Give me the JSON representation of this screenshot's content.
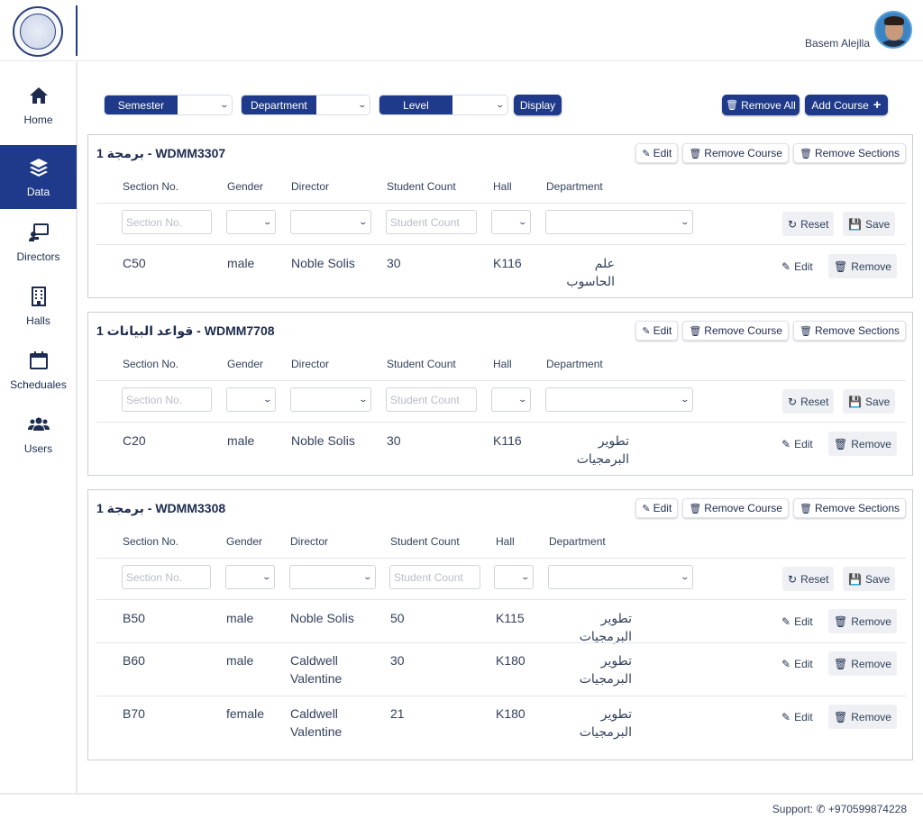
{
  "header": {
    "username": "Basem Alejlla",
    "logo_icon": "university-logo",
    "avatar_icon": "user-avatar"
  },
  "sidebar": {
    "items": [
      {
        "label": "Home",
        "icon": "home-icon",
        "active": false
      },
      {
        "label": "Data",
        "icon": "layers-icon",
        "active": true
      },
      {
        "label": "Directors",
        "icon": "chalkboard-teacher-icon",
        "active": false
      },
      {
        "label": "Halls",
        "icon": "building-icon",
        "active": false
      },
      {
        "label": "Scheduales",
        "icon": "calendar-icon",
        "active": false
      },
      {
        "label": "Users",
        "icon": "users-icon",
        "active": false
      }
    ]
  },
  "filters": {
    "semester_label": "Semester",
    "department_label": "Department",
    "level_label": "Level",
    "display_label": "Display",
    "remove_all_label": "Remove All",
    "add_course_label": "Add Course"
  },
  "actions": {
    "edit": "Edit",
    "remove_course": "Remove Course",
    "remove_sections": "Remove Sections",
    "reset": "Reset",
    "save": "Save",
    "remove": "Remove"
  },
  "columns": [
    "Section No.",
    "Gender",
    "Director",
    "Student Count",
    "Hall",
    "Department"
  ],
  "placeholders": {
    "section_no": "Section No.",
    "student_count": "Student Count"
  },
  "courses": [
    {
      "title": "برمجة 1 - WDMM3307",
      "sections": [
        {
          "section": "C50",
          "gender": "male",
          "director": "Noble Solis",
          "count": "30",
          "hall": "K116",
          "department": "علم الحاسوب"
        }
      ]
    },
    {
      "title": "قواعد البيانات 1 - WDMM7708",
      "sections": [
        {
          "section": "C20",
          "gender": "male",
          "director": "Noble Solis",
          "count": "30",
          "hall": "K116",
          "department": "تطوير البرمجيات"
        }
      ]
    },
    {
      "title": "برمجة 1 - WDMM3308",
      "sections": [
        {
          "section": "B50",
          "gender": "male",
          "director": "Noble Solis",
          "count": "50",
          "hall": "K115",
          "department": "تطوير البرمجيات"
        },
        {
          "section": "B60",
          "gender": "male",
          "director": "Caldwell Valentine",
          "count": "30",
          "hall": "K180",
          "department": "تطوير البرمجيات"
        },
        {
          "section": "B70",
          "gender": "female",
          "director": "Caldwell Valentine",
          "count": "21",
          "hall": "K180",
          "department": "تطوير البرمجيات"
        }
      ]
    }
  ],
  "footer": {
    "support_label": "Support:",
    "phone": "+970599874228",
    "phone_icon": "phone-icon"
  }
}
